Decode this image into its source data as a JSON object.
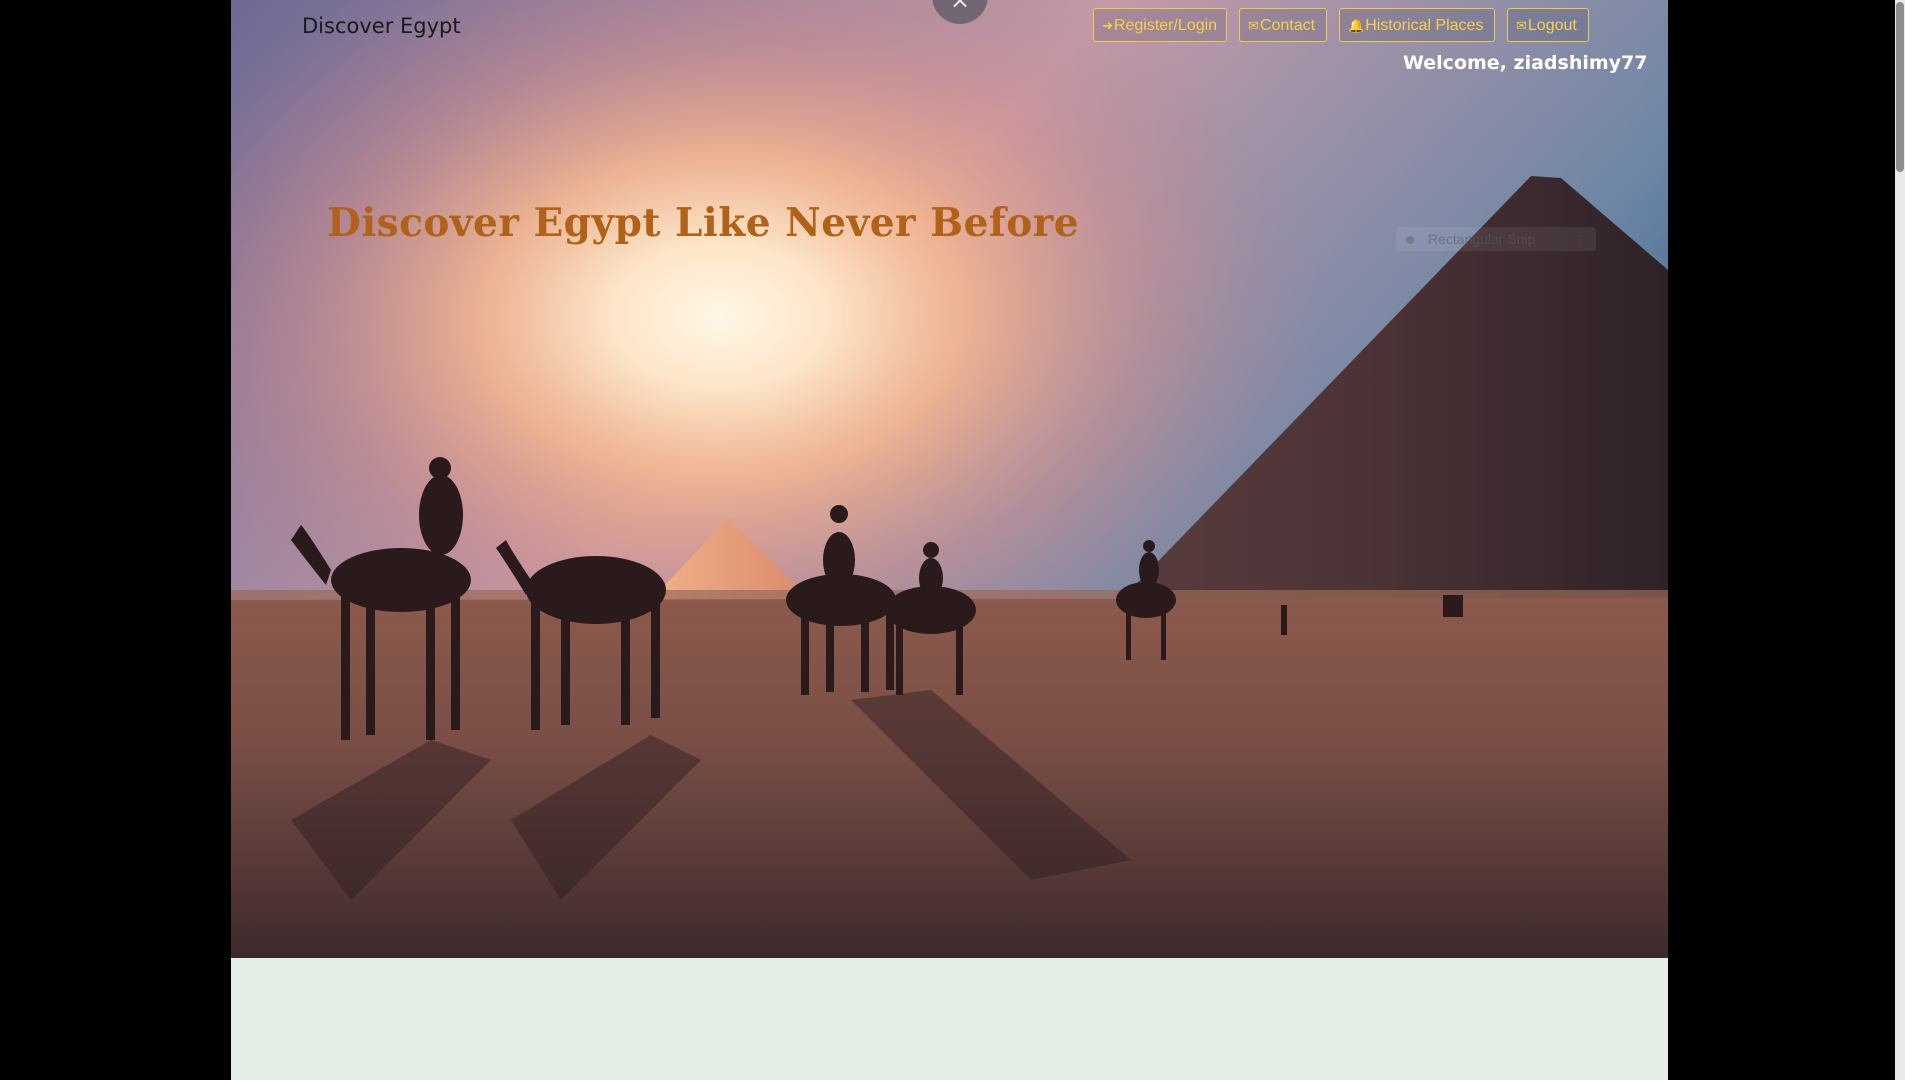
{
  "header": {
    "brand": "Discover Egypt",
    "close_symbol": "×"
  },
  "nav": {
    "items": [
      {
        "label": "Register/Login",
        "icon": "sign-in-icon",
        "glyph": "➜"
      },
      {
        "label": "Contact",
        "icon": "envelope-icon",
        "glyph": "✉"
      },
      {
        "label": "Historical Places",
        "icon": "bell-icon",
        "glyph": "🔔"
      },
      {
        "label": "Logout",
        "icon": "envelope-icon",
        "glyph": "✉"
      }
    ]
  },
  "welcome": "Welcome, ziadshimy77",
  "hero": {
    "headline": "Discover Egypt Like Never Before"
  },
  "overlay": {
    "snip_label": "Rectangular Snip",
    "chevron": "⌄"
  },
  "colors": {
    "page_bg": "#000000",
    "content_bg": "#e4eee7",
    "accent_yellow": "#f6d04d",
    "headline": "#b0621a"
  }
}
